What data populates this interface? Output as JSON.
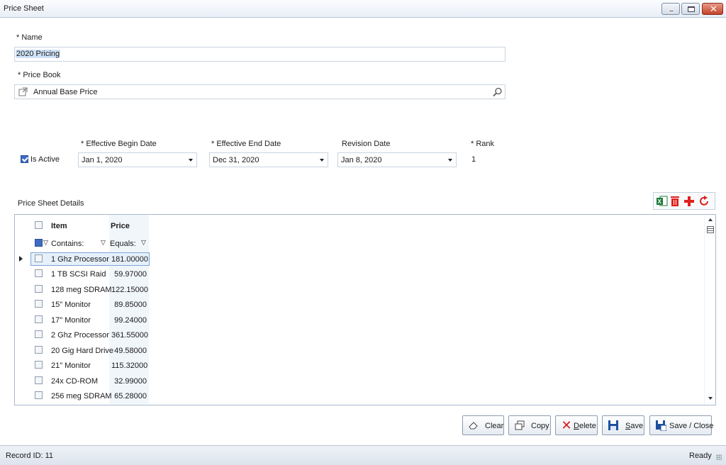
{
  "window": {
    "title": "Price Sheet"
  },
  "form": {
    "name_label": "* Name",
    "name_value": "2020 Pricing",
    "price_book_label": "* Price Book",
    "price_book_value": "Annual Base Price",
    "is_active_label": "Is Active",
    "is_active_checked": true,
    "effective_begin_label": "* Effective Begin Date",
    "effective_begin_value": "Jan 1, 2020",
    "effective_end_label": "* Effective End Date",
    "effective_end_value": "Dec 31, 2020",
    "revision_label": "Revision Date",
    "revision_value": "Jan 8, 2020",
    "rank_label": "* Rank",
    "rank_value": "1"
  },
  "details": {
    "section_label": "Price Sheet Details",
    "toolbar_icons": [
      "excel-export-icon",
      "delete-icon",
      "add-icon",
      "refresh-icon"
    ],
    "columns": [
      "Item",
      "Price"
    ],
    "filters": {
      "item": "Contains:",
      "price": "Equals:"
    },
    "rows": [
      {
        "item": "1 Ghz Processor",
        "price": "181.00000"
      },
      {
        "item": "1 TB SCSI Raid",
        "price": "59.97000"
      },
      {
        "item": "128 meg SDRAM",
        "price": "122.15000"
      },
      {
        "item": "15\" Monitor",
        "price": "89.85000"
      },
      {
        "item": "17\" Monitor",
        "price": "99.24000"
      },
      {
        "item": "2 Ghz Processor",
        "price": "361.55000"
      },
      {
        "item": "20 Gig Hard Drive",
        "price": "49.58000"
      },
      {
        "item": "21\" Monitor",
        "price": "115.32000"
      },
      {
        "item": "24x CD-ROM",
        "price": "32.99000"
      },
      {
        "item": "256 meg SDRAM",
        "price": "65.28000"
      }
    ]
  },
  "buttons": {
    "clear": "Clear",
    "copy": "Copy",
    "delete_first": "D",
    "delete_rest": "elete",
    "save_first": "S",
    "save_rest": "ave",
    "save_close": "Save / Close"
  },
  "status": {
    "record_id": "Record ID: 11",
    "state": "Ready"
  },
  "colors": {
    "accent": "#3e6cc4",
    "close": "#c4412a",
    "add": "#e0201b"
  }
}
